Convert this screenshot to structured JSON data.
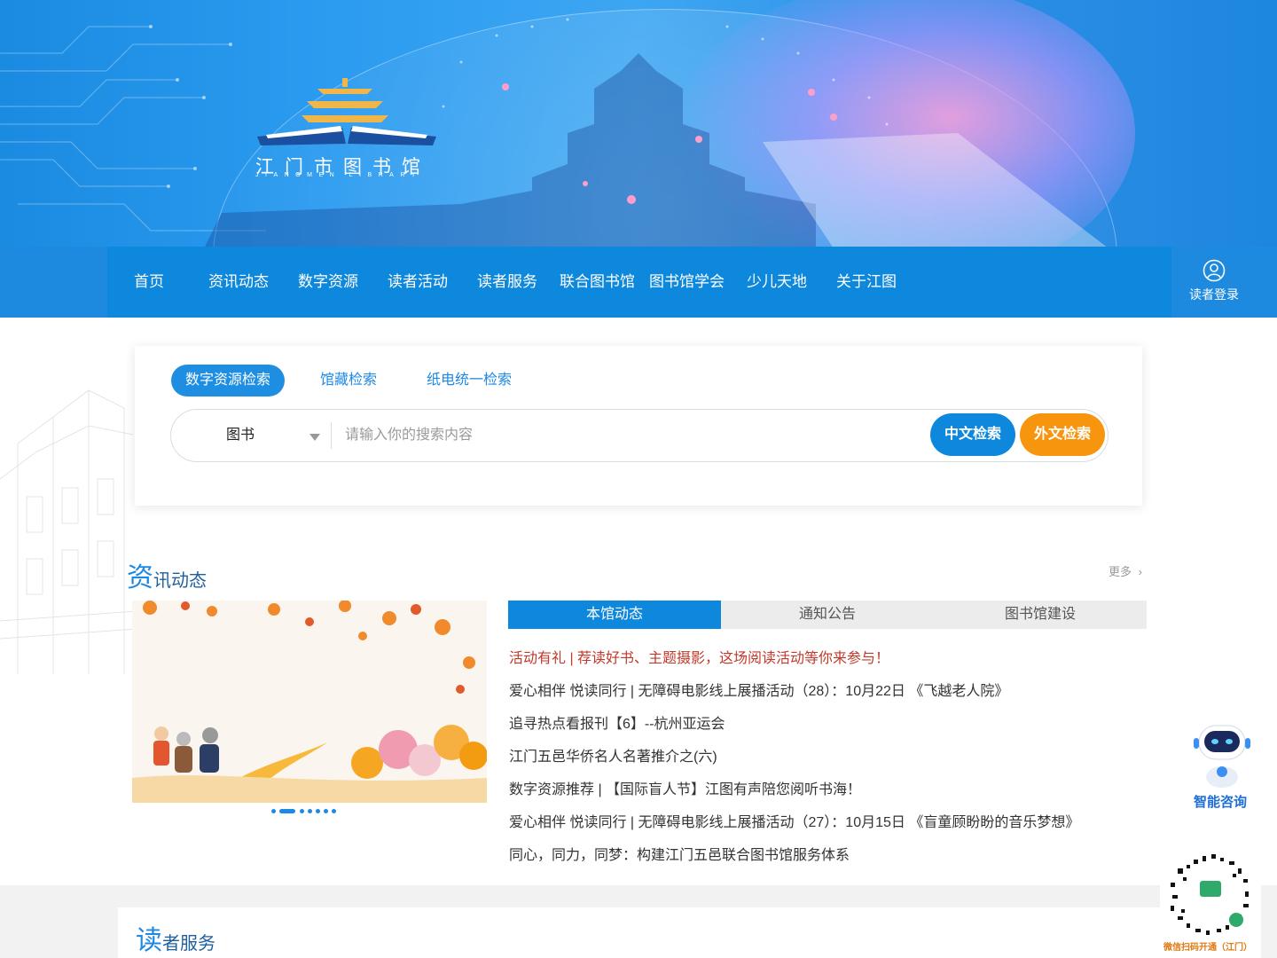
{
  "logo": {
    "name": "江门市图书馆",
    "subtitle": "JIANGMEN LIBRARY"
  },
  "nav": {
    "items": [
      {
        "label": "首页"
      },
      {
        "label": "资讯动态"
      },
      {
        "label": "数字资源"
      },
      {
        "label": "读者活动"
      },
      {
        "label": "读者服务"
      },
      {
        "label": "联合图书馆"
      },
      {
        "label": "图书馆学会"
      },
      {
        "label": "少儿天地"
      },
      {
        "label": "关于江图"
      }
    ],
    "login_label": "读者登录"
  },
  "search": {
    "tabs": [
      {
        "label": "数字资源检索",
        "active": true
      },
      {
        "label": "馆藏检索",
        "active": false
      },
      {
        "label": "纸电统一检索",
        "active": false
      }
    ],
    "type_selected": "图书",
    "placeholder": "请输入你的搜索内容",
    "value": "",
    "btn_chinese": "中文检索",
    "btn_foreign": "外文检索"
  },
  "news": {
    "title_big": "资",
    "title_rest": "讯动态",
    "more_label": "更多",
    "tabs": [
      {
        "label": "本馆动态",
        "active": true
      },
      {
        "label": "通知公告",
        "active": false
      },
      {
        "label": "图书馆建设",
        "active": false
      }
    ],
    "items": [
      {
        "text": "活动有礼 | 荐读好书、主题摄影，这场阅读活动等你来参与！",
        "highlight": true
      },
      {
        "text": "爱心相伴 悦读同行 | 无障碍电影线上展播活动（28）：10月22日 《飞越老人院》",
        "highlight": false
      },
      {
        "text": "追寻热点看报刊【6】--杭州亚运会",
        "highlight": false
      },
      {
        "text": "江门五邑华侨名人名著推介之(六)",
        "highlight": false
      },
      {
        "text": "数字资源推荐 | 【国际盲人节】江图有声陪您阅听书海！",
        "highlight": false
      },
      {
        "text": "爱心相伴 悦读同行 | 无障碍电影线上展播活动（27）：10月15日 《盲童顾盼盼的音乐梦想》",
        "highlight": false
      },
      {
        "text": "同心，同力，同梦：构建江门五邑联合图书馆服务体系",
        "highlight": false
      }
    ],
    "slides_total": 7,
    "slide_active": 2
  },
  "service": {
    "title_big": "读",
    "title_rest": "者服务"
  },
  "widgets": {
    "assistant_label": "智能咨询",
    "qr_label": "微信扫码开通（江门）"
  },
  "colors": {
    "primary": "#0e88dc",
    "accent_orange": "#f7950f",
    "highlight_red": "#c0392b"
  }
}
